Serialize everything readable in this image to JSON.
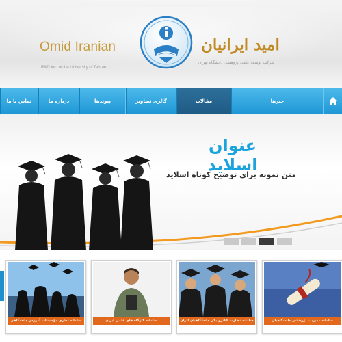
{
  "header": {
    "logo_latin": "Omid Iranian",
    "logo_persian": "امید ایرانیان",
    "tagline_latin": "R&D Inc. of the University of Tehran",
    "tagline_persian": "شرکت توسعه علمی پژوهشی دانشگاه تهران"
  },
  "nav": {
    "items": [
      {
        "label": "تماس با ما",
        "active": false
      },
      {
        "label": "درباره ما",
        "active": false
      },
      {
        "label": "پیوندها",
        "active": false
      },
      {
        "label": "گالری تصاویر",
        "active": false
      },
      {
        "label": "مقالات",
        "active": true
      },
      {
        "label": "خبرها",
        "active": false
      }
    ],
    "home_icon": "home-icon"
  },
  "slider": {
    "title": "عنوان اسلاید",
    "description": "متن نمونه برای توضیح کوتاه اسلاید",
    "dot_count": 4,
    "active_dot": 2
  },
  "cards": [
    {
      "caption": "سامانه مدیریت پژوهشی دانشگاهیان"
    },
    {
      "caption": "سامانه نظارت الکترونیکی دانشگاهیان ایران"
    },
    {
      "caption": "سامانه کارگاه های علمی ایران"
    },
    {
      "caption": "سامانه تجاری مؤسسات آموزش دانشگاهی"
    }
  ],
  "colors": {
    "nav_blue": "#2ea6df",
    "nav_active": "#24648f",
    "title_blue": "#1aa3dd",
    "caption_orange": "#e1681d",
    "logo_gold": "#c69a3a"
  }
}
